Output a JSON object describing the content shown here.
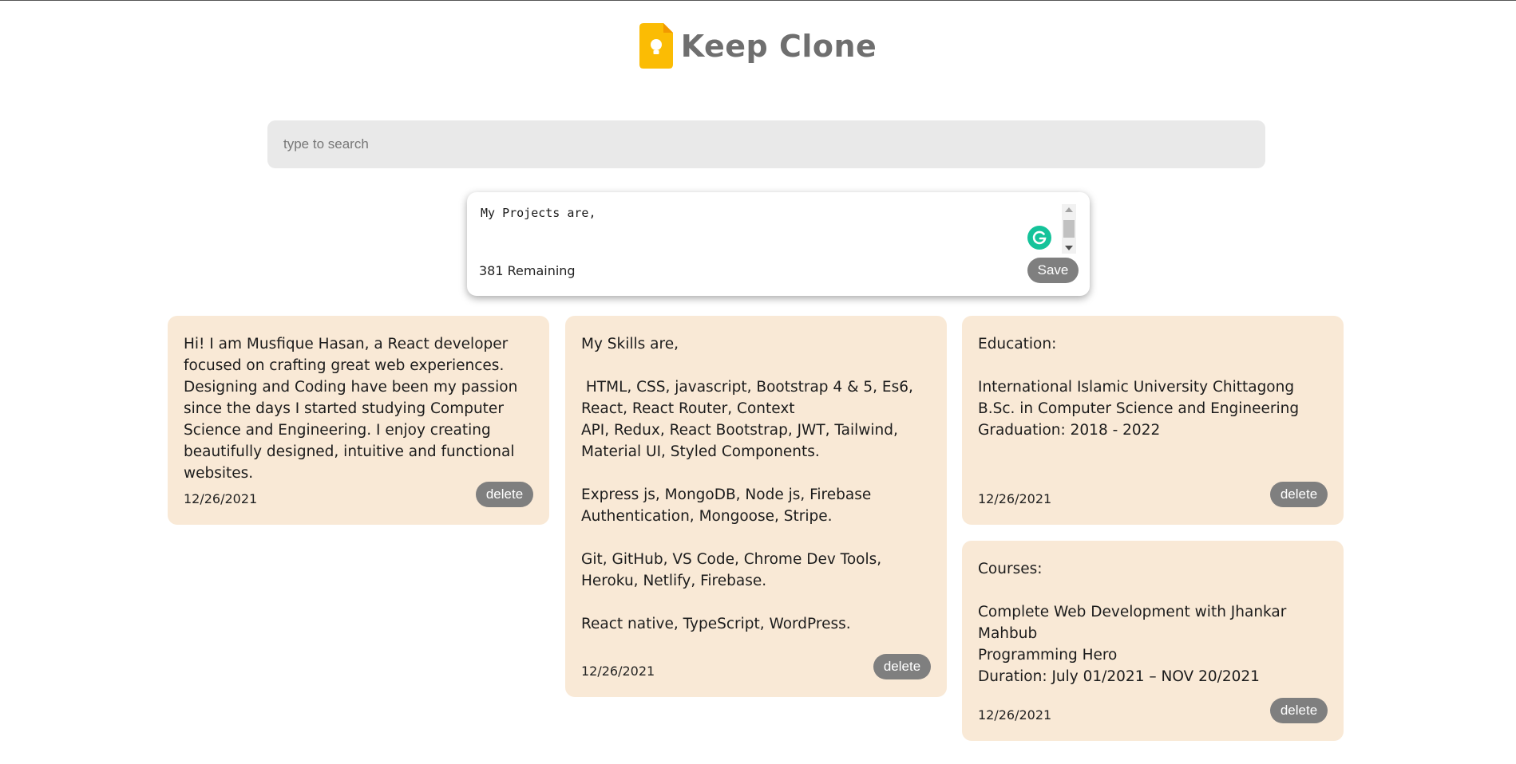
{
  "app": {
    "title": "Keep Clone",
    "brand_color": "#fbbc04",
    "logo_icon": "keep-bulb-icon"
  },
  "search": {
    "placeholder": "type to search",
    "value": ""
  },
  "composer": {
    "text": "My Projects are,",
    "remaining": "381 Remaining",
    "save_label": "Save"
  },
  "notes": [
    {
      "text": "Hi! I am Musfique Hasan, a React developer focused on crafting great web experiences. Designing and Coding have been my passion since the days I started studying Computer Science and Engineering. I enjoy creating beautifully designed, intuitive and functional websites.",
      "date": "12/26/2021",
      "delete_label": "delete"
    },
    {
      "text": "My Skills are,\n\n HTML, CSS, javascript, Bootstrap 4 & 5, Es6, React, React Router, Context\nAPI, Redux, React Bootstrap, JWT, Tailwind, Material UI, Styled Components.\n\nExpress js, MongoDB, Node js, Firebase Authentication, Mongoose, Stripe.\n\nGit, GitHub, VS Code, Chrome Dev Tools, Heroku, Netlify, Firebase.\n\nReact native, TypeScript, WordPress.\n",
      "date": "12/26/2021",
      "delete_label": "delete"
    },
    {
      "text": "Education:\n\nInternational Islamic University Chittagong\nB.Sc. in Computer Science and Engineering\nGraduation: 2018 - 2022",
      "date": "12/26/2021",
      "delete_label": "delete"
    },
    {
      "text": "Courses:\n\nComplete Web Development with Jhankar Mahbub\nProgramming Hero\nDuration: July 01/2021 – NOV 20/2021\n",
      "date": "12/26/2021",
      "delete_label": "delete"
    }
  ],
  "colors": {
    "note_background": "#f9e9d6",
    "button": "#7f7f7f",
    "search_background": "#e9e9e9"
  }
}
